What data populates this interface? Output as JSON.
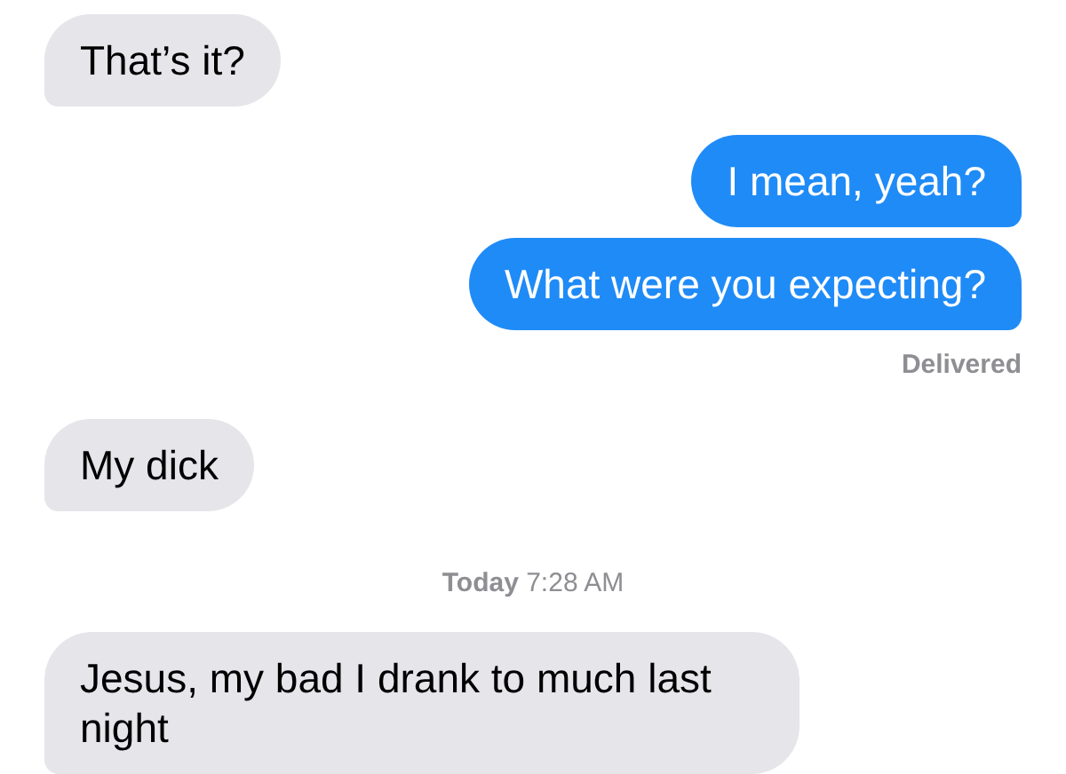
{
  "messages": [
    {
      "kind": "received",
      "text": "That’s it?"
    },
    {
      "kind": "sent",
      "text": "I mean, yeah?"
    },
    {
      "kind": "sent",
      "text": "What were you expecting?"
    },
    {
      "kind": "status",
      "text": "Delivered"
    },
    {
      "kind": "received",
      "text": "My dick"
    },
    {
      "kind": "timestamp",
      "text": "**Today** 7:28 AM"
    },
    {
      "kind": "received",
      "text": "Jesus, my bad I drank to much last night"
    }
  ]
}
